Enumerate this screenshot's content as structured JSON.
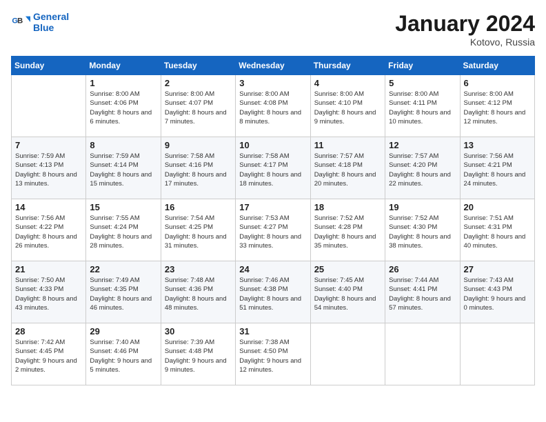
{
  "header": {
    "logo_general": "General",
    "logo_blue": "Blue",
    "month": "January 2024",
    "location": "Kotovo, Russia"
  },
  "weekdays": [
    "Sunday",
    "Monday",
    "Tuesday",
    "Wednesday",
    "Thursday",
    "Friday",
    "Saturday"
  ],
  "weeks": [
    [
      {
        "day": "",
        "sunrise": "",
        "sunset": "",
        "daylight": ""
      },
      {
        "day": "1",
        "sunrise": "Sunrise: 8:00 AM",
        "sunset": "Sunset: 4:06 PM",
        "daylight": "Daylight: 8 hours and 6 minutes."
      },
      {
        "day": "2",
        "sunrise": "Sunrise: 8:00 AM",
        "sunset": "Sunset: 4:07 PM",
        "daylight": "Daylight: 8 hours and 7 minutes."
      },
      {
        "day": "3",
        "sunrise": "Sunrise: 8:00 AM",
        "sunset": "Sunset: 4:08 PM",
        "daylight": "Daylight: 8 hours and 8 minutes."
      },
      {
        "day": "4",
        "sunrise": "Sunrise: 8:00 AM",
        "sunset": "Sunset: 4:10 PM",
        "daylight": "Daylight: 8 hours and 9 minutes."
      },
      {
        "day": "5",
        "sunrise": "Sunrise: 8:00 AM",
        "sunset": "Sunset: 4:11 PM",
        "daylight": "Daylight: 8 hours and 10 minutes."
      },
      {
        "day": "6",
        "sunrise": "Sunrise: 8:00 AM",
        "sunset": "Sunset: 4:12 PM",
        "daylight": "Daylight: 8 hours and 12 minutes."
      }
    ],
    [
      {
        "day": "7",
        "sunrise": "Sunrise: 7:59 AM",
        "sunset": "Sunset: 4:13 PM",
        "daylight": "Daylight: 8 hours and 13 minutes."
      },
      {
        "day": "8",
        "sunrise": "Sunrise: 7:59 AM",
        "sunset": "Sunset: 4:14 PM",
        "daylight": "Daylight: 8 hours and 15 minutes."
      },
      {
        "day": "9",
        "sunrise": "Sunrise: 7:58 AM",
        "sunset": "Sunset: 4:16 PM",
        "daylight": "Daylight: 8 hours and 17 minutes."
      },
      {
        "day": "10",
        "sunrise": "Sunrise: 7:58 AM",
        "sunset": "Sunset: 4:17 PM",
        "daylight": "Daylight: 8 hours and 18 minutes."
      },
      {
        "day": "11",
        "sunrise": "Sunrise: 7:57 AM",
        "sunset": "Sunset: 4:18 PM",
        "daylight": "Daylight: 8 hours and 20 minutes."
      },
      {
        "day": "12",
        "sunrise": "Sunrise: 7:57 AM",
        "sunset": "Sunset: 4:20 PM",
        "daylight": "Daylight: 8 hours and 22 minutes."
      },
      {
        "day": "13",
        "sunrise": "Sunrise: 7:56 AM",
        "sunset": "Sunset: 4:21 PM",
        "daylight": "Daylight: 8 hours and 24 minutes."
      }
    ],
    [
      {
        "day": "14",
        "sunrise": "Sunrise: 7:56 AM",
        "sunset": "Sunset: 4:22 PM",
        "daylight": "Daylight: 8 hours and 26 minutes."
      },
      {
        "day": "15",
        "sunrise": "Sunrise: 7:55 AM",
        "sunset": "Sunset: 4:24 PM",
        "daylight": "Daylight: 8 hours and 28 minutes."
      },
      {
        "day": "16",
        "sunrise": "Sunrise: 7:54 AM",
        "sunset": "Sunset: 4:25 PM",
        "daylight": "Daylight: 8 hours and 31 minutes."
      },
      {
        "day": "17",
        "sunrise": "Sunrise: 7:53 AM",
        "sunset": "Sunset: 4:27 PM",
        "daylight": "Daylight: 8 hours and 33 minutes."
      },
      {
        "day": "18",
        "sunrise": "Sunrise: 7:52 AM",
        "sunset": "Sunset: 4:28 PM",
        "daylight": "Daylight: 8 hours and 35 minutes."
      },
      {
        "day": "19",
        "sunrise": "Sunrise: 7:52 AM",
        "sunset": "Sunset: 4:30 PM",
        "daylight": "Daylight: 8 hours and 38 minutes."
      },
      {
        "day": "20",
        "sunrise": "Sunrise: 7:51 AM",
        "sunset": "Sunset: 4:31 PM",
        "daylight": "Daylight: 8 hours and 40 minutes."
      }
    ],
    [
      {
        "day": "21",
        "sunrise": "Sunrise: 7:50 AM",
        "sunset": "Sunset: 4:33 PM",
        "daylight": "Daylight: 8 hours and 43 minutes."
      },
      {
        "day": "22",
        "sunrise": "Sunrise: 7:49 AM",
        "sunset": "Sunset: 4:35 PM",
        "daylight": "Daylight: 8 hours and 46 minutes."
      },
      {
        "day": "23",
        "sunrise": "Sunrise: 7:48 AM",
        "sunset": "Sunset: 4:36 PM",
        "daylight": "Daylight: 8 hours and 48 minutes."
      },
      {
        "day": "24",
        "sunrise": "Sunrise: 7:46 AM",
        "sunset": "Sunset: 4:38 PM",
        "daylight": "Daylight: 8 hours and 51 minutes."
      },
      {
        "day": "25",
        "sunrise": "Sunrise: 7:45 AM",
        "sunset": "Sunset: 4:40 PM",
        "daylight": "Daylight: 8 hours and 54 minutes."
      },
      {
        "day": "26",
        "sunrise": "Sunrise: 7:44 AM",
        "sunset": "Sunset: 4:41 PM",
        "daylight": "Daylight: 8 hours and 57 minutes."
      },
      {
        "day": "27",
        "sunrise": "Sunrise: 7:43 AM",
        "sunset": "Sunset: 4:43 PM",
        "daylight": "Daylight: 9 hours and 0 minutes."
      }
    ],
    [
      {
        "day": "28",
        "sunrise": "Sunrise: 7:42 AM",
        "sunset": "Sunset: 4:45 PM",
        "daylight": "Daylight: 9 hours and 2 minutes."
      },
      {
        "day": "29",
        "sunrise": "Sunrise: 7:40 AM",
        "sunset": "Sunset: 4:46 PM",
        "daylight": "Daylight: 9 hours and 5 minutes."
      },
      {
        "day": "30",
        "sunrise": "Sunrise: 7:39 AM",
        "sunset": "Sunset: 4:48 PM",
        "daylight": "Daylight: 9 hours and 9 minutes."
      },
      {
        "day": "31",
        "sunrise": "Sunrise: 7:38 AM",
        "sunset": "Sunset: 4:50 PM",
        "daylight": "Daylight: 9 hours and 12 minutes."
      },
      {
        "day": "",
        "sunrise": "",
        "sunset": "",
        "daylight": ""
      },
      {
        "day": "",
        "sunrise": "",
        "sunset": "",
        "daylight": ""
      },
      {
        "day": "",
        "sunrise": "",
        "sunset": "",
        "daylight": ""
      }
    ]
  ]
}
